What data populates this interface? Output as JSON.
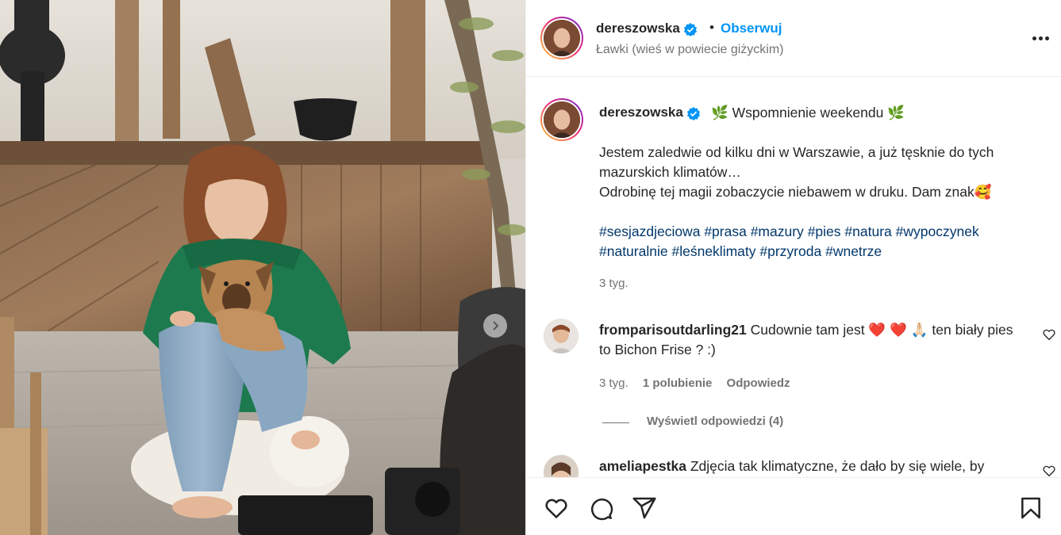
{
  "post": {
    "username": "dereszowska",
    "follow_label": "Obserwuj",
    "separator": "•",
    "location": "Ławki (wieś w powiecie giżyckim)",
    "caption_title": "🌿 Wspomnienie weekendu  🌿",
    "caption_line1": "Jestem zaledwie od kilku dni w Warszawie, a już tęsknie do tych mazurskich klimatów…",
    "caption_line2": "Odrobinę tej magii zobaczycie niebawem w druku. Dam znak🥰",
    "hashtags": [
      "#sesjazdjeciowa",
      "#prasa",
      "#mazury",
      "#pies",
      "#natura",
      "#wypoczynek",
      "#naturalnie",
      "#leśneklimaty",
      "#przyroda",
      "#wnetrze"
    ],
    "time": "3 tyg."
  },
  "comments": [
    {
      "username": "fromparisoutdarling21",
      "text": "Cudownie tam jest ❤️ ❤️ 🙏🏻  ten biały pies to Bichon Frise ? :)",
      "time": "3 tyg.",
      "likes": "1 polubienie",
      "reply_label": "Odpowiedz",
      "view_replies": "Wyświetl odpowiedzi (4)"
    },
    {
      "username": "ameliapestka",
      "text": "Zdjęcia tak klimatyczne, że dało by się wiele, by"
    }
  ],
  "icons": {
    "verified": "verified-badge-icon",
    "more": "more-options-icon",
    "like": "heart-icon",
    "comment": "comment-icon",
    "share": "share-icon",
    "save": "bookmark-icon",
    "carousel": "chevron-right-icon"
  },
  "colors": {
    "accent": "#0095f6",
    "hashtag": "#00376b",
    "muted": "#737373",
    "text": "#262626"
  }
}
